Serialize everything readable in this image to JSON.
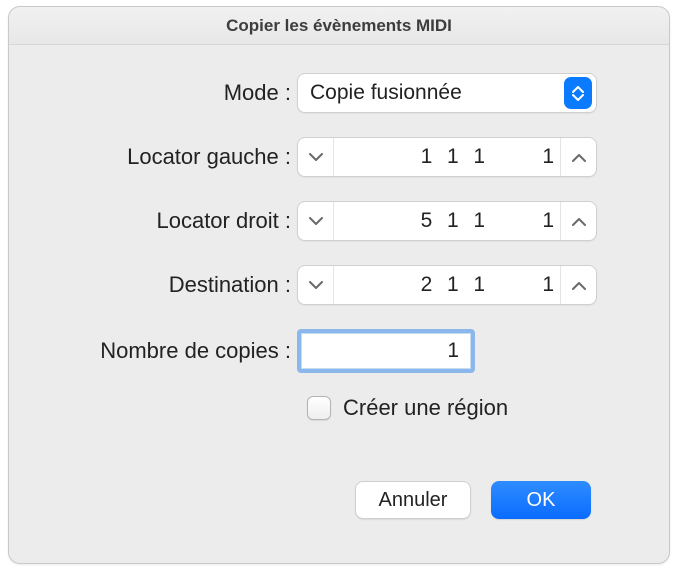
{
  "window": {
    "title": "Copier les évènements MIDI"
  },
  "labels": {
    "mode": "Mode :",
    "left_locator": "Locator gauche :",
    "right_locator": "Locator droit :",
    "destination": "Destination :",
    "copies": "Nombre de copies :"
  },
  "mode": {
    "selected": "Copie fusionnée"
  },
  "left_locator": {
    "bars": "1",
    "beats": "1",
    "div": "1",
    "ticks": "1"
  },
  "right_locator": {
    "bars": "5",
    "beats": "1",
    "div": "1",
    "ticks": "1"
  },
  "destination": {
    "bars": "2",
    "beats": "1",
    "div": "1",
    "ticks": "1"
  },
  "copies": {
    "value": "1"
  },
  "create_region": {
    "label": "Créer une région",
    "checked": false
  },
  "buttons": {
    "cancel": "Annuler",
    "ok": "OK"
  }
}
